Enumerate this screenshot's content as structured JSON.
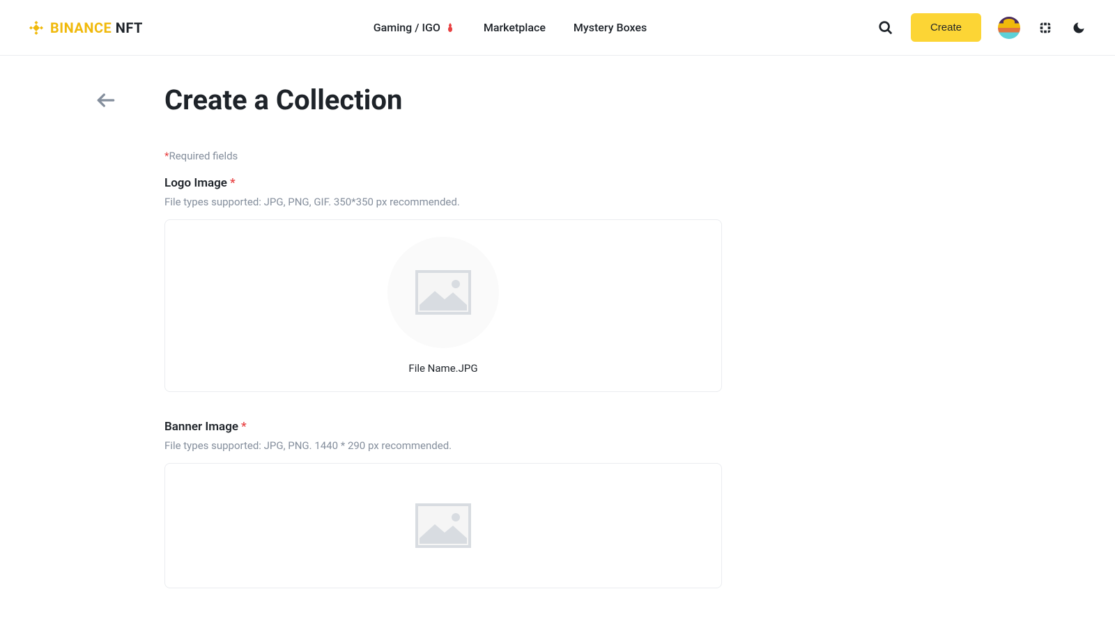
{
  "header": {
    "logo_brand": "BINANCE",
    "logo_suffix": " NFT",
    "nav": {
      "gaming": "Gaming / IGO",
      "marketplace": "Marketplace",
      "mystery": "Mystery Boxes"
    },
    "create_label": "Create"
  },
  "page": {
    "title": "Create a Collection",
    "required_note": "Required fields"
  },
  "fields": {
    "logo": {
      "label": "Logo Image",
      "hint": "File types supported: JPG, PNG, GIF. 350*350 px recommended.",
      "file_name": "File Name.JPG"
    },
    "banner": {
      "label": "Banner Image",
      "hint": "File types supported: JPG, PNG. 1440 * 290 px recommended."
    }
  }
}
